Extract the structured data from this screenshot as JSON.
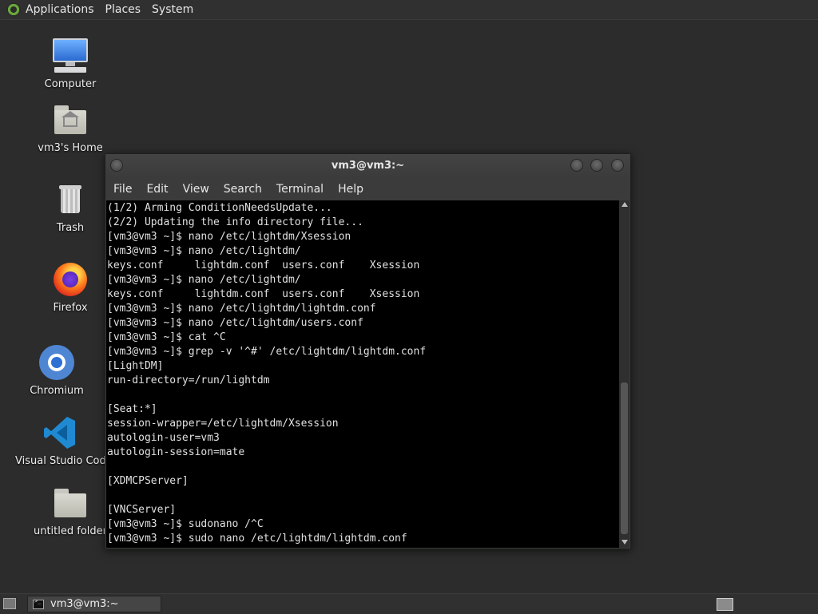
{
  "top_panel": {
    "menus": [
      "Applications",
      "Places",
      "System"
    ]
  },
  "desktop": {
    "icons": [
      {
        "label": "Computer",
        "icon": "computer-icon"
      },
      {
        "label": "vm3's Home",
        "icon": "home-folder-icon"
      },
      {
        "label": "Trash",
        "icon": "trash-icon"
      },
      {
        "label": "Firefox",
        "icon": "firefox-icon"
      },
      {
        "label": "Chromium",
        "icon": "chromium-icon"
      },
      {
        "label": "Visual Studio Code",
        "icon": "vscode-icon"
      },
      {
        "label": "untitled folder",
        "icon": "folder-icon"
      }
    ]
  },
  "terminal": {
    "title": "vm3@vm3:~",
    "menu": [
      "File",
      "Edit",
      "View",
      "Search",
      "Terminal",
      "Help"
    ],
    "lines": [
      "(1/2) Arming ConditionNeedsUpdate...",
      "(2/2) Updating the info directory file...",
      "[vm3@vm3 ~]$ nano /etc/lightdm/Xsession",
      "[vm3@vm3 ~]$ nano /etc/lightdm/",
      "keys.conf     lightdm.conf  users.conf    Xsession",
      "[vm3@vm3 ~]$ nano /etc/lightdm/",
      "keys.conf     lightdm.conf  users.conf    Xsession",
      "[vm3@vm3 ~]$ nano /etc/lightdm/lightdm.conf",
      "[vm3@vm3 ~]$ nano /etc/lightdm/users.conf",
      "[vm3@vm3 ~]$ cat ^C",
      "[vm3@vm3 ~]$ grep -v '^#' /etc/lightdm/lightdm.conf",
      "[LightDM]",
      "run-directory=/run/lightdm",
      "",
      "[Seat:*]",
      "session-wrapper=/etc/lightdm/Xsession",
      "autologin-user=vm3",
      "autologin-session=mate",
      "",
      "[XDMCPServer]",
      "",
      "[VNCServer]",
      "[vm3@vm3 ~]$ sudonano /^C",
      "[vm3@vm3 ~]$ sudo nano /etc/lightdm/lightdm.conf"
    ]
  },
  "taskbar": {
    "tasks": [
      {
        "label": "vm3@vm3:~"
      }
    ]
  }
}
